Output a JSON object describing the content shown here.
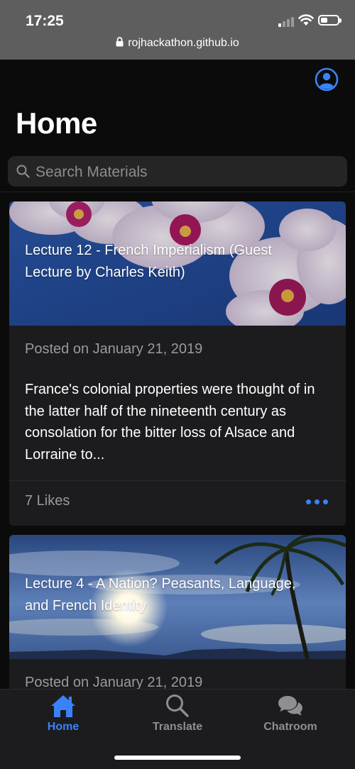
{
  "status": {
    "time": "17:25",
    "url": "rojhackathon.github.io"
  },
  "header": {
    "title": "Home",
    "profile_icon": "person-circle-icon",
    "accent_color": "#3a82f7"
  },
  "search": {
    "placeholder": "Search Materials",
    "value": ""
  },
  "posts": [
    {
      "title": "Lecture 12 - French Imperialism (Guest Lecture by Charles Keith)",
      "image": "orchid-flowers",
      "date": "Posted on January 21, 2019",
      "excerpt": "France's colonial properties were thought of in the latter half of the nineteenth century as consolation for the bitter loss of Alsace and Lorraine to...",
      "likes": "7 Likes"
    },
    {
      "title": "Lecture 4 - A Nation? Peasants, Language, and French Identity",
      "image": "palm-tree-sunset",
      "date": "Posted on January 21, 2019"
    }
  ],
  "tabs": [
    {
      "label": "Home",
      "icon": "home-icon",
      "active": true
    },
    {
      "label": "Translate",
      "icon": "search-icon",
      "active": false
    },
    {
      "label": "Chatroom",
      "icon": "chat-bubbles-icon",
      "active": false
    }
  ]
}
